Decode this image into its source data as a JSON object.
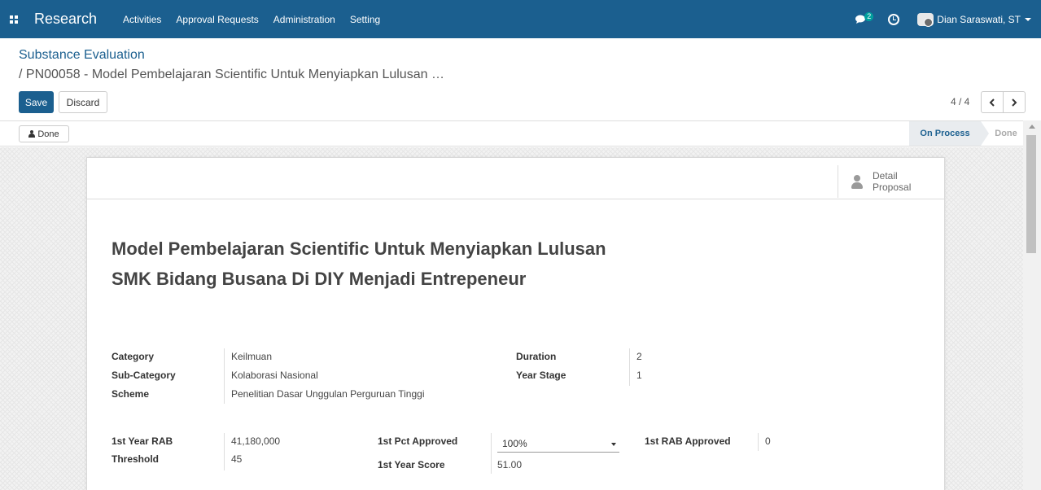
{
  "navbar": {
    "brand": "Research",
    "menu": [
      "Activities",
      "Approval Requests",
      "Administration",
      "Setting"
    ],
    "chat_badge": "2",
    "user_name": "Dian Saraswati, ST",
    "color": "#1b5f8f"
  },
  "breadcrumb": {
    "parent": "Substance Evaluation",
    "current": "/ PN00058 - Model Pembelajaran Scientific Untuk Menyiapkan Lulusan …"
  },
  "actions": {
    "save": "Save",
    "discard": "Discard"
  },
  "pager": {
    "value": "4 / 4"
  },
  "statusbar": {
    "done_button": "Done",
    "stages": [
      "On Process",
      "Done"
    ],
    "active_stage": "On Process"
  },
  "detail_button": {
    "label": "Detail Proposal"
  },
  "record": {
    "title": "Model Pembelajaran Scientific Untuk Menyiapkan Lulusan SMK Bidang Busana Di DIY Menjadi Entrepeneur",
    "category_label": "Category",
    "category": "Keilmuan",
    "subcategory_label": "Sub-Category",
    "subcategory": "Kolaborasi Nasional",
    "scheme_label": "Scheme",
    "scheme": "Penelitian Dasar Unggulan Perguruan Tinggi",
    "duration_label": "Duration",
    "duration": "2",
    "year_stage_label": "Year Stage",
    "year_stage": "1",
    "rab_label": "1st Year RAB",
    "rab": "41,180,000",
    "threshold_label": "Threshold",
    "threshold": "45",
    "pct_approved_label": "1st Pct Approved",
    "pct_approved": "100%",
    "year_score_label": "1st Year Score",
    "year_score": "51.00",
    "rab_approved_label": "1st RAB Approved",
    "rab_approved": "0"
  }
}
